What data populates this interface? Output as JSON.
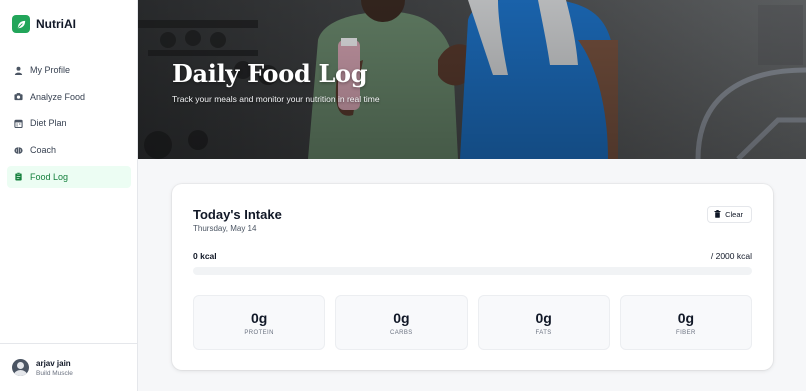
{
  "app": {
    "name": "NutriAI",
    "brand_color": "#22a55a"
  },
  "sidebar": {
    "items": [
      {
        "label": "My Profile",
        "icon": "user-icon",
        "active": false
      },
      {
        "label": "Analyze Food",
        "icon": "camera-icon",
        "active": false
      },
      {
        "label": "Diet Plan",
        "icon": "calendar-icon",
        "active": false
      },
      {
        "label": "Coach",
        "icon": "brain-icon",
        "active": false
      },
      {
        "label": "Food Log",
        "icon": "clipboard-icon",
        "active": true
      }
    ]
  },
  "user": {
    "name": "arjav jain",
    "goal": "Build Muscle"
  },
  "hero": {
    "title": "Daily Food Log",
    "subtitle": "Track your meals and monitor your nutrition in real time"
  },
  "intake": {
    "title": "Today's Intake",
    "date": "Thursday, May 14",
    "clear_label": "Clear",
    "consumed": "0 kcal",
    "goal": "/ 2000 kcal",
    "progress_fraction": 0,
    "macros": [
      {
        "value": "0g",
        "label": "PROTEIN"
      },
      {
        "value": "0g",
        "label": "CARBS"
      },
      {
        "value": "0g",
        "label": "FATS"
      },
      {
        "value": "0g",
        "label": "FIBER"
      }
    ]
  }
}
